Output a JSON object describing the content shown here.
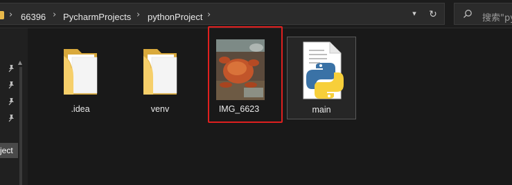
{
  "address_bar": {
    "crumbs": [
      "66396",
      "PycharmProjects",
      "pythonProject"
    ],
    "separator": "›"
  },
  "search": {
    "placeholder": "搜索\"py"
  },
  "nav": {
    "selected_label": "ject"
  },
  "items": [
    {
      "name": ".idea",
      "type": "folder"
    },
    {
      "name": "venv",
      "type": "folder"
    },
    {
      "name": "IMG_6623",
      "type": "image"
    },
    {
      "name": "main",
      "type": "python-file"
    }
  ],
  "colors": {
    "annotation": "#e0201f",
    "folder": "#f2c75c",
    "python_blue": "#3a72a6",
    "python_yellow": "#f7cf3a"
  }
}
